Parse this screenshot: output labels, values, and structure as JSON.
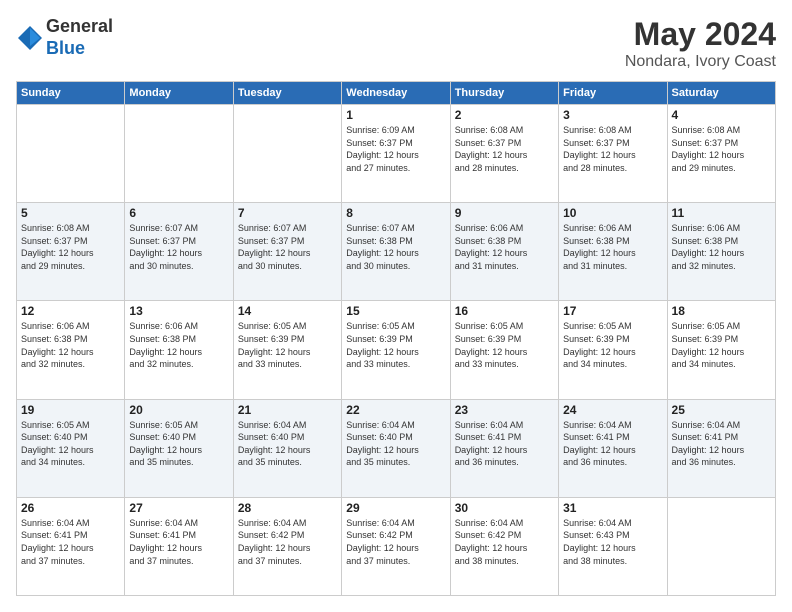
{
  "header": {
    "logo_line1": "General",
    "logo_line2": "Blue",
    "title": "May 2024",
    "location": "Nondara, Ivory Coast"
  },
  "days_of_week": [
    "Sunday",
    "Monday",
    "Tuesday",
    "Wednesday",
    "Thursday",
    "Friday",
    "Saturday"
  ],
  "weeks": [
    [
      {
        "day": "",
        "info": ""
      },
      {
        "day": "",
        "info": ""
      },
      {
        "day": "",
        "info": ""
      },
      {
        "day": "1",
        "info": "Sunrise: 6:09 AM\nSunset: 6:37 PM\nDaylight: 12 hours\nand 27 minutes."
      },
      {
        "day": "2",
        "info": "Sunrise: 6:08 AM\nSunset: 6:37 PM\nDaylight: 12 hours\nand 28 minutes."
      },
      {
        "day": "3",
        "info": "Sunrise: 6:08 AM\nSunset: 6:37 PM\nDaylight: 12 hours\nand 28 minutes."
      },
      {
        "day": "4",
        "info": "Sunrise: 6:08 AM\nSunset: 6:37 PM\nDaylight: 12 hours\nand 29 minutes."
      }
    ],
    [
      {
        "day": "5",
        "info": "Sunrise: 6:08 AM\nSunset: 6:37 PM\nDaylight: 12 hours\nand 29 minutes."
      },
      {
        "day": "6",
        "info": "Sunrise: 6:07 AM\nSunset: 6:37 PM\nDaylight: 12 hours\nand 30 minutes."
      },
      {
        "day": "7",
        "info": "Sunrise: 6:07 AM\nSunset: 6:37 PM\nDaylight: 12 hours\nand 30 minutes."
      },
      {
        "day": "8",
        "info": "Sunrise: 6:07 AM\nSunset: 6:38 PM\nDaylight: 12 hours\nand 30 minutes."
      },
      {
        "day": "9",
        "info": "Sunrise: 6:06 AM\nSunset: 6:38 PM\nDaylight: 12 hours\nand 31 minutes."
      },
      {
        "day": "10",
        "info": "Sunrise: 6:06 AM\nSunset: 6:38 PM\nDaylight: 12 hours\nand 31 minutes."
      },
      {
        "day": "11",
        "info": "Sunrise: 6:06 AM\nSunset: 6:38 PM\nDaylight: 12 hours\nand 32 minutes."
      }
    ],
    [
      {
        "day": "12",
        "info": "Sunrise: 6:06 AM\nSunset: 6:38 PM\nDaylight: 12 hours\nand 32 minutes."
      },
      {
        "day": "13",
        "info": "Sunrise: 6:06 AM\nSunset: 6:38 PM\nDaylight: 12 hours\nand 32 minutes."
      },
      {
        "day": "14",
        "info": "Sunrise: 6:05 AM\nSunset: 6:39 PM\nDaylight: 12 hours\nand 33 minutes."
      },
      {
        "day": "15",
        "info": "Sunrise: 6:05 AM\nSunset: 6:39 PM\nDaylight: 12 hours\nand 33 minutes."
      },
      {
        "day": "16",
        "info": "Sunrise: 6:05 AM\nSunset: 6:39 PM\nDaylight: 12 hours\nand 33 minutes."
      },
      {
        "day": "17",
        "info": "Sunrise: 6:05 AM\nSunset: 6:39 PM\nDaylight: 12 hours\nand 34 minutes."
      },
      {
        "day": "18",
        "info": "Sunrise: 6:05 AM\nSunset: 6:39 PM\nDaylight: 12 hours\nand 34 minutes."
      }
    ],
    [
      {
        "day": "19",
        "info": "Sunrise: 6:05 AM\nSunset: 6:40 PM\nDaylight: 12 hours\nand 34 minutes."
      },
      {
        "day": "20",
        "info": "Sunrise: 6:05 AM\nSunset: 6:40 PM\nDaylight: 12 hours\nand 35 minutes."
      },
      {
        "day": "21",
        "info": "Sunrise: 6:04 AM\nSunset: 6:40 PM\nDaylight: 12 hours\nand 35 minutes."
      },
      {
        "day": "22",
        "info": "Sunrise: 6:04 AM\nSunset: 6:40 PM\nDaylight: 12 hours\nand 35 minutes."
      },
      {
        "day": "23",
        "info": "Sunrise: 6:04 AM\nSunset: 6:41 PM\nDaylight: 12 hours\nand 36 minutes."
      },
      {
        "day": "24",
        "info": "Sunrise: 6:04 AM\nSunset: 6:41 PM\nDaylight: 12 hours\nand 36 minutes."
      },
      {
        "day": "25",
        "info": "Sunrise: 6:04 AM\nSunset: 6:41 PM\nDaylight: 12 hours\nand 36 minutes."
      }
    ],
    [
      {
        "day": "26",
        "info": "Sunrise: 6:04 AM\nSunset: 6:41 PM\nDaylight: 12 hours\nand 37 minutes."
      },
      {
        "day": "27",
        "info": "Sunrise: 6:04 AM\nSunset: 6:41 PM\nDaylight: 12 hours\nand 37 minutes."
      },
      {
        "day": "28",
        "info": "Sunrise: 6:04 AM\nSunset: 6:42 PM\nDaylight: 12 hours\nand 37 minutes."
      },
      {
        "day": "29",
        "info": "Sunrise: 6:04 AM\nSunset: 6:42 PM\nDaylight: 12 hours\nand 37 minutes."
      },
      {
        "day": "30",
        "info": "Sunrise: 6:04 AM\nSunset: 6:42 PM\nDaylight: 12 hours\nand 38 minutes."
      },
      {
        "day": "31",
        "info": "Sunrise: 6:04 AM\nSunset: 6:43 PM\nDaylight: 12 hours\nand 38 minutes."
      },
      {
        "day": "",
        "info": ""
      }
    ]
  ]
}
